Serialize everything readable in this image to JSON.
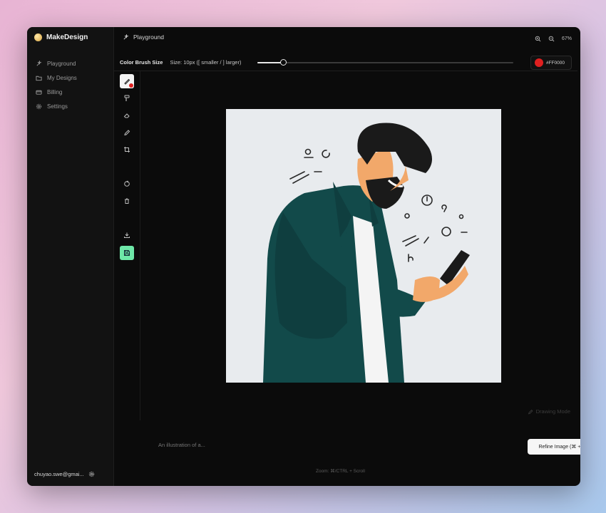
{
  "app": {
    "name": "MakeDesign"
  },
  "sidebar": {
    "items": [
      {
        "label": "Playground",
        "icon": "sparkle-icon"
      },
      {
        "label": "My Designs",
        "icon": "folder-icon"
      },
      {
        "label": "Billing",
        "icon": "card-icon"
      },
      {
        "label": "Settings",
        "icon": "gear-icon"
      }
    ],
    "user_email": "chuyao.swe@gmai..."
  },
  "header": {
    "crumb": "Playground",
    "zoom_level": "67%"
  },
  "toolbar": {
    "title": "Color Brush Size",
    "size_text": "Size: 10px ([ smaller / ] larger)",
    "brush_fraction": 0.1,
    "color_hex": "#FF0000",
    "color": "#e02020"
  },
  "tools": [
    {
      "name": "brush-tool",
      "icon": "brush-icon",
      "active": true
    },
    {
      "name": "color-picker-tool",
      "icon": "color-picker-icon"
    },
    {
      "name": "eraser-tool",
      "icon": "eraser-icon"
    },
    {
      "name": "pen-tool",
      "icon": "pen-icon"
    },
    {
      "name": "crop-tool",
      "icon": "crop-icon"
    },
    {
      "name": "reset-tool",
      "icon": "reset-icon"
    },
    {
      "name": "delete-tool",
      "icon": "trash-icon"
    },
    {
      "name": "download-tool",
      "icon": "download-icon"
    },
    {
      "name": "save-tool",
      "icon": "save-icon"
    }
  ],
  "canvas": {
    "mode_label": "Drawing Mode"
  },
  "prompt": {
    "placeholder": "An illustration of a...",
    "refine_label": "Refine Image (⌘ + ↵)"
  },
  "footer": {
    "zoom_hint": "Zoom: ⌘/CTRL + Scroll"
  }
}
